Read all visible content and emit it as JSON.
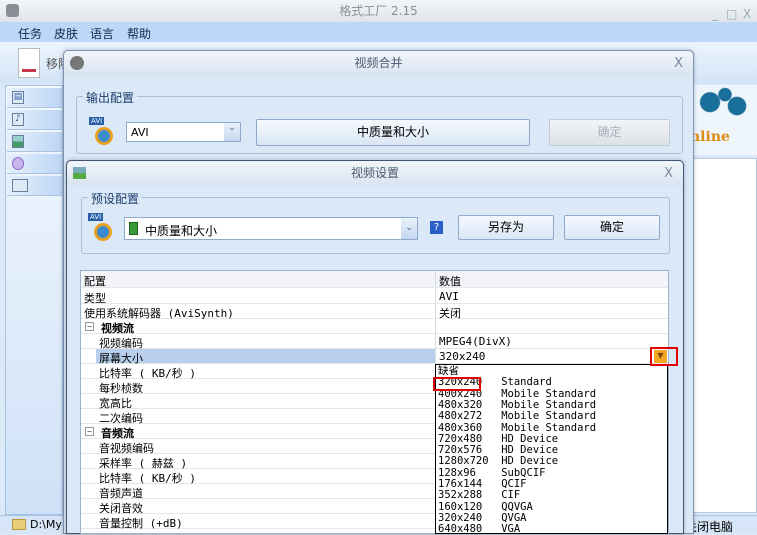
{
  "app": {
    "title": "格式工厂 2.15",
    "window_controls": [
      "_",
      "□",
      "X"
    ],
    "menu": [
      "任务",
      "皮肤",
      "语言",
      "帮助"
    ],
    "toolbar_remove": "移除",
    "status_path": "D:\\My D",
    "shutdown_label": "关闭电脑",
    "online_text": "nline"
  },
  "sidebar": {
    "items": [
      {
        "icon": "video-icon"
      },
      {
        "icon": "audio-icon"
      },
      {
        "icon": "picture-icon"
      },
      {
        "icon": "disc-icon"
      },
      {
        "icon": "advanced-icon"
      }
    ]
  },
  "merge_dialog": {
    "title": "视频合并",
    "close": "X",
    "group_label": "输出配置",
    "format_value": "AVI",
    "quality_button": "中质量和大小",
    "ok_button": "确定",
    "format_icon_label": "AVI"
  },
  "settings_dialog": {
    "title": "视频设置",
    "close": "X",
    "group_label": "预设配置",
    "preset_value": "中质量和大小",
    "help_label": "?",
    "save_as_button": "另存为",
    "ok_button": "确定",
    "table": {
      "headers": [
        "配置",
        "数值"
      ],
      "rows": [
        {
          "key": "类型",
          "value": "AVI",
          "level": 0
        },
        {
          "key": "使用系统解码器 (AviSynth)",
          "value": "关闭",
          "level": 0
        },
        {
          "key": "视频流",
          "value": "",
          "level": "section"
        },
        {
          "key": "视频编码",
          "value": "MPEG4(DivX)",
          "level": 1
        },
        {
          "key": "屏幕大小",
          "value": "320x240",
          "level": 1,
          "selected": true
        },
        {
          "key": "比特率 ( KB/秒 )",
          "value": "",
          "level": 1
        },
        {
          "key": "每秒桢数",
          "value": "",
          "level": 1
        },
        {
          "key": "宽高比",
          "value": "",
          "level": 1
        },
        {
          "key": "二次编码",
          "value": "",
          "level": 1
        },
        {
          "key": "音频流",
          "value": "",
          "level": "section"
        },
        {
          "key": "音视频编码",
          "value": "",
          "level": 1
        },
        {
          "key": "采样率 ( 赫兹 )",
          "value": "",
          "level": 1
        },
        {
          "key": "比特率 ( KB/秒 )",
          "value": "",
          "level": 1
        },
        {
          "key": "音频声道",
          "value": "",
          "level": 1
        },
        {
          "key": "关闭音效",
          "value": "",
          "level": 1
        },
        {
          "key": "音量控制 (+dB)",
          "value": "",
          "level": 1
        }
      ]
    },
    "dropdown_options": [
      "缺省",
      "320x240   Standard",
      "400x240   Mobile Standard",
      "480x320   Mobile Standard",
      "480x272   Mobile Standard",
      "480x360   Mobile Standard",
      "720x480   HD Device",
      "720x576   HD Device",
      "1280x720  HD Device",
      "128x96    SubQCIF",
      "176x144   QCIF",
      "352x288   CIF",
      "160x120   QQVGA",
      "320x240   QVGA",
      "640x480   VGA"
    ],
    "highlighted_option": "320x240"
  },
  "colors": {
    "highlight": "#e00000",
    "selected_row": "#b9cfee",
    "arrow_button": "#f5a623"
  }
}
